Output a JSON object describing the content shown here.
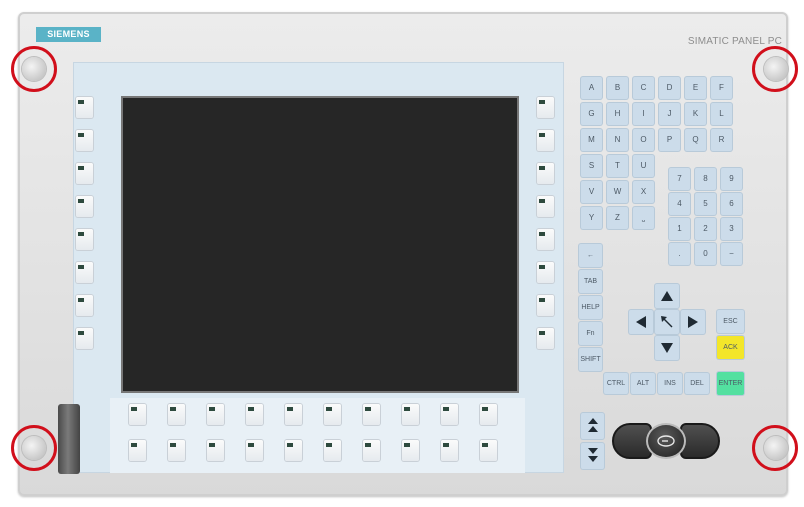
{
  "panel": {
    "brand": "SIEMENS",
    "model": "SIMATIC PANEL PC"
  },
  "keyboard": {
    "alpha": [
      "A",
      "B",
      "C",
      "D",
      "E",
      "F",
      "G",
      "H",
      "I",
      "J",
      "K",
      "L",
      "M",
      "N",
      "O",
      "P",
      "Q",
      "R",
      "S",
      "T",
      "U",
      "V",
      "W",
      "X",
      "Y",
      "Z",
      "⎵"
    ],
    "numpad": [
      "7",
      "8",
      "9",
      "4",
      "5",
      "6",
      "1",
      "2",
      "3",
      ".",
      "0",
      "−"
    ],
    "function_keys": [
      "←",
      "TAB",
      "HELP",
      "Fn",
      "SHIFT"
    ],
    "control_keys": [
      "CTRL",
      "ALT",
      "INS",
      "DEL"
    ],
    "esc": "ESC",
    "ack": "ACK",
    "enter": "ENTER",
    "colors": {
      "key": "#ccdcea",
      "ack": "#f3e62a",
      "enter": "#53e0a0"
    }
  },
  "icons": {
    "arrows": [
      "up-arrow-icon",
      "down-arrow-icon",
      "left-arrow-icon",
      "right-arrow-icon",
      "home-arrow-icon"
    ],
    "page_keys": [
      "page-up-icon",
      "page-down-icon"
    ],
    "mouse": "mouse-button-icon"
  }
}
